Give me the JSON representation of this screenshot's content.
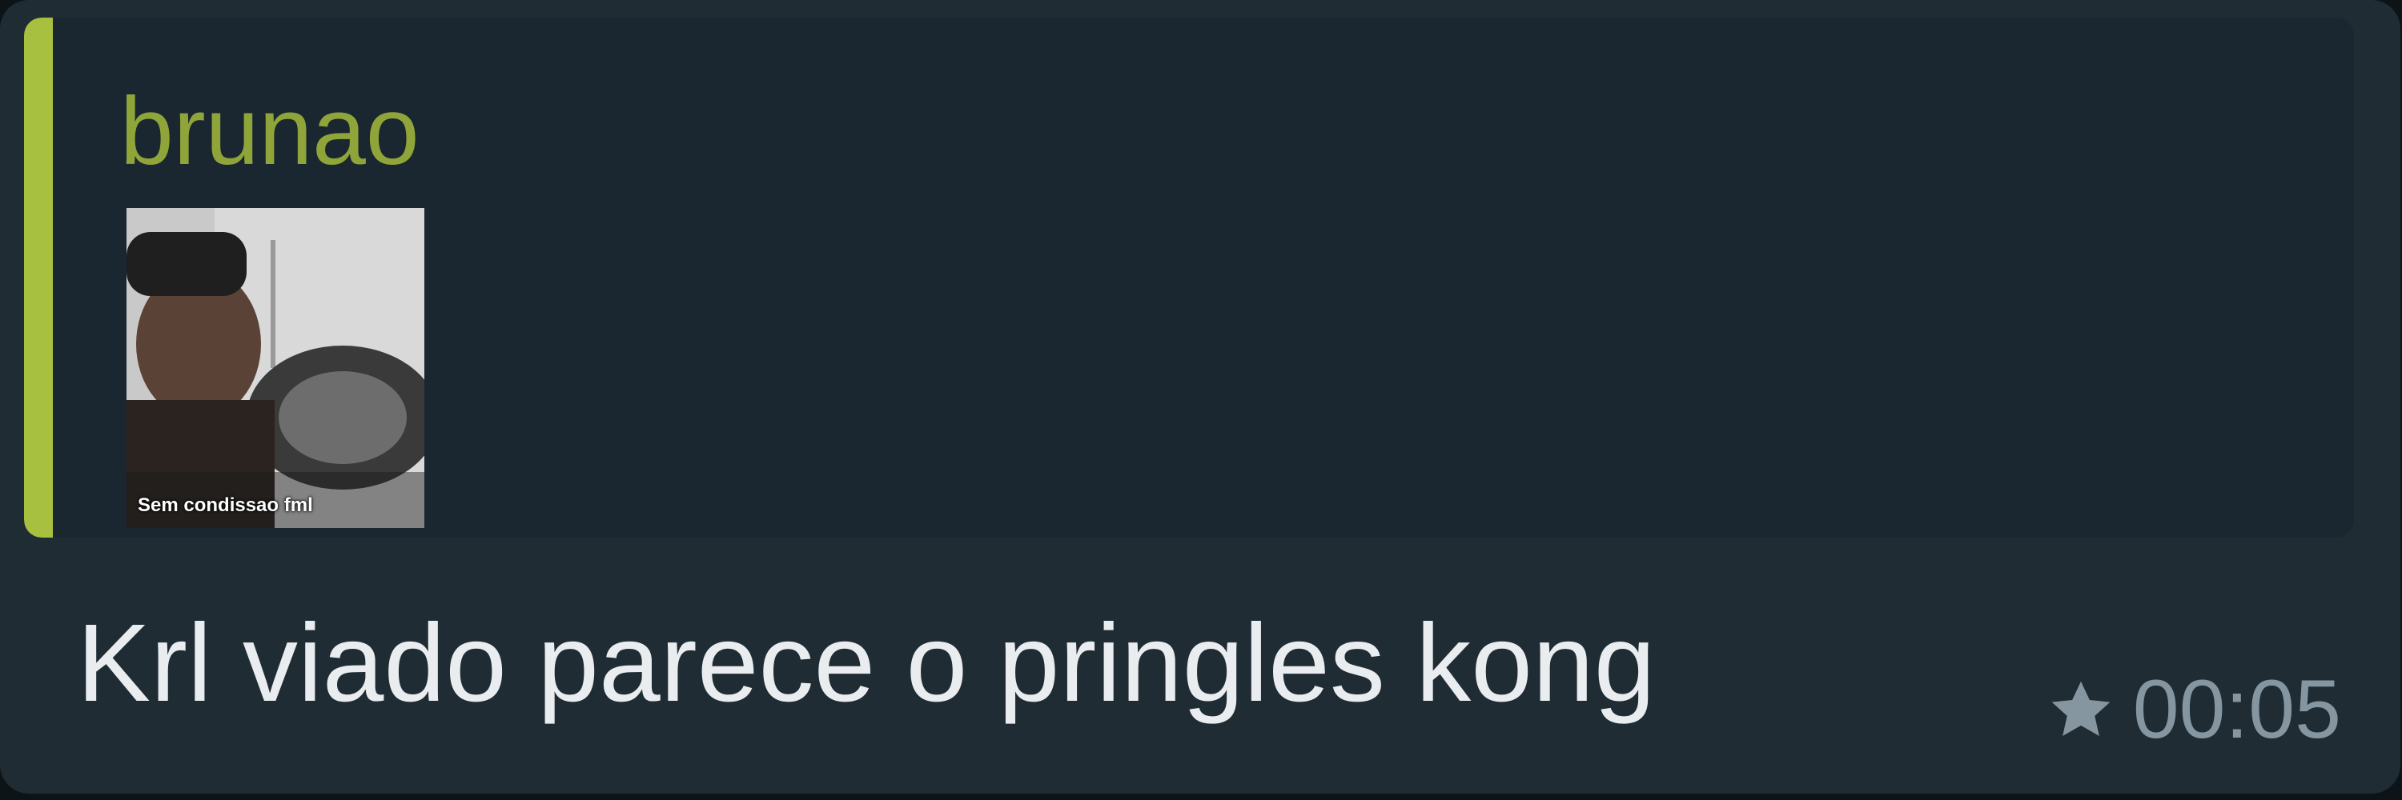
{
  "quoted_message": {
    "author": "brunao",
    "thumbnail_caption": "Sem condissao fml"
  },
  "message": {
    "text": "Krl viado parece o pringles kong",
    "timestamp": "00:05",
    "starred": true
  },
  "icons": {
    "star": "star-icon"
  },
  "colors": {
    "bubble_background": "#1f2c34",
    "quote_background": "#1b2730",
    "quote_accent": "#a8c040",
    "author_color": "#8fa53a",
    "message_text": "#e9edef",
    "meta_text": "#8696a0"
  }
}
